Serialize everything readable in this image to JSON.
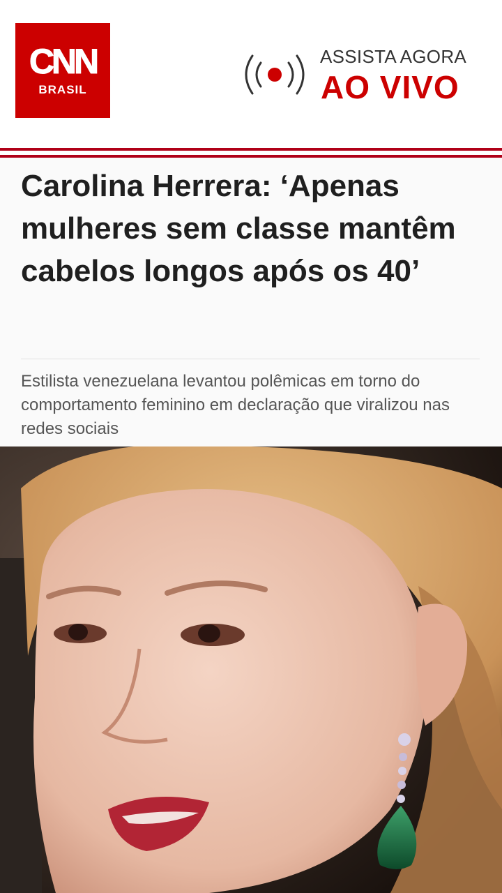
{
  "header": {
    "logo": {
      "brand": "CNN",
      "region": "BRASIL"
    },
    "live": {
      "line1": "ASSISTA AGORA",
      "line2": "AO VIVO"
    }
  },
  "article": {
    "headline": "Carolina Herrera: ‘Apenas mulheres sem classe mantêm cabelos longos após os 40’",
    "subtitle": "Estilista venezuelana levantou polêmicas em torno do comportamento feminino em declaração que viralizou nas redes sociais"
  },
  "colors": {
    "brand_red": "#cc0000",
    "rule_red": "#b00018",
    "headline": "#1f1f1f",
    "subtitle": "#555555"
  }
}
